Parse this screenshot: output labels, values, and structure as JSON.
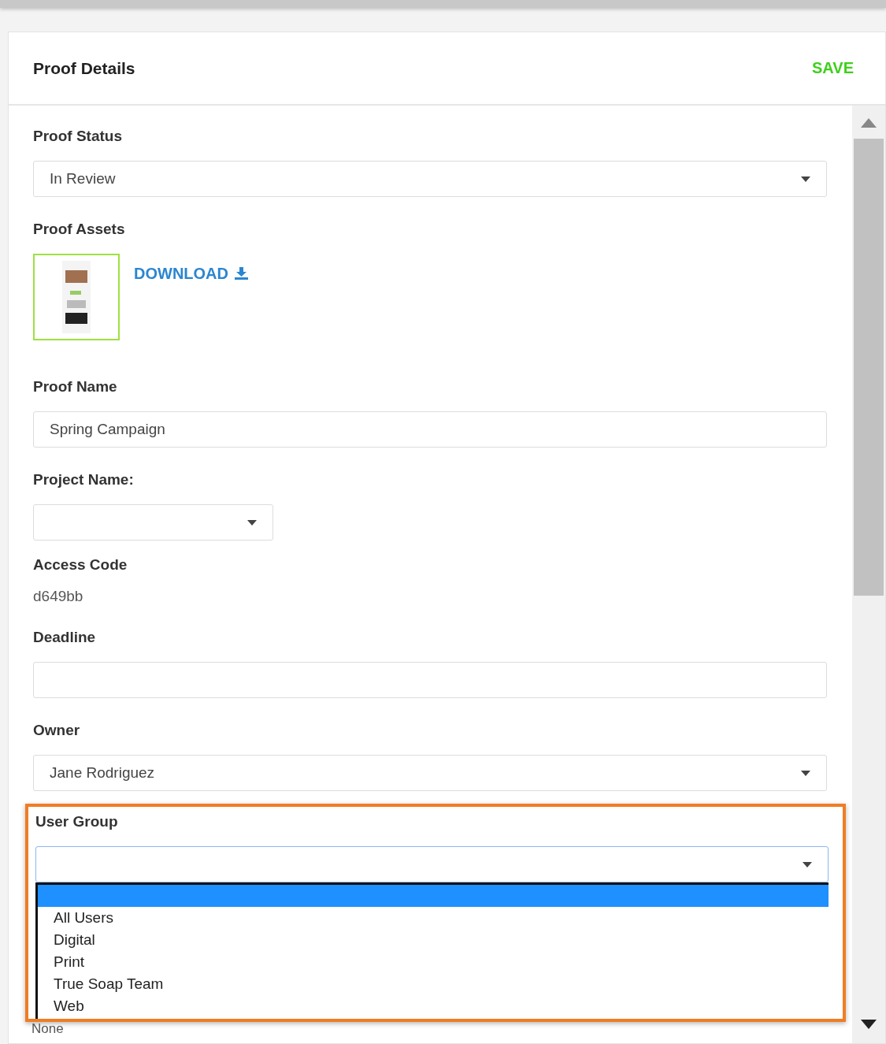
{
  "panel": {
    "title": "Proof Details",
    "save": "SAVE"
  },
  "proof_status": {
    "label": "Proof Status",
    "value": "In Review"
  },
  "proof_assets": {
    "label": "Proof Assets",
    "download": "DOWNLOAD"
  },
  "proof_name": {
    "label": "Proof Name",
    "value": "Spring Campaign"
  },
  "project_name": {
    "label": "Project Name:"
  },
  "access_code": {
    "label": "Access Code",
    "value": "d649bb"
  },
  "deadline": {
    "label": "Deadline"
  },
  "owner": {
    "label": "Owner",
    "value": "Jane Rodriguez"
  },
  "user_group": {
    "label": "User Group",
    "highlighted": true,
    "options": [
      {
        "selected": true
      },
      {
        "label": "All Users",
        "selected": false
      },
      {
        "label": "Digital",
        "selected": false
      },
      {
        "label": "Print",
        "selected": false
      },
      {
        "label": "True Soap Team",
        "selected": false
      },
      {
        "label": "Web",
        "selected": false
      }
    ]
  },
  "partial_field": {
    "value": "None"
  }
}
